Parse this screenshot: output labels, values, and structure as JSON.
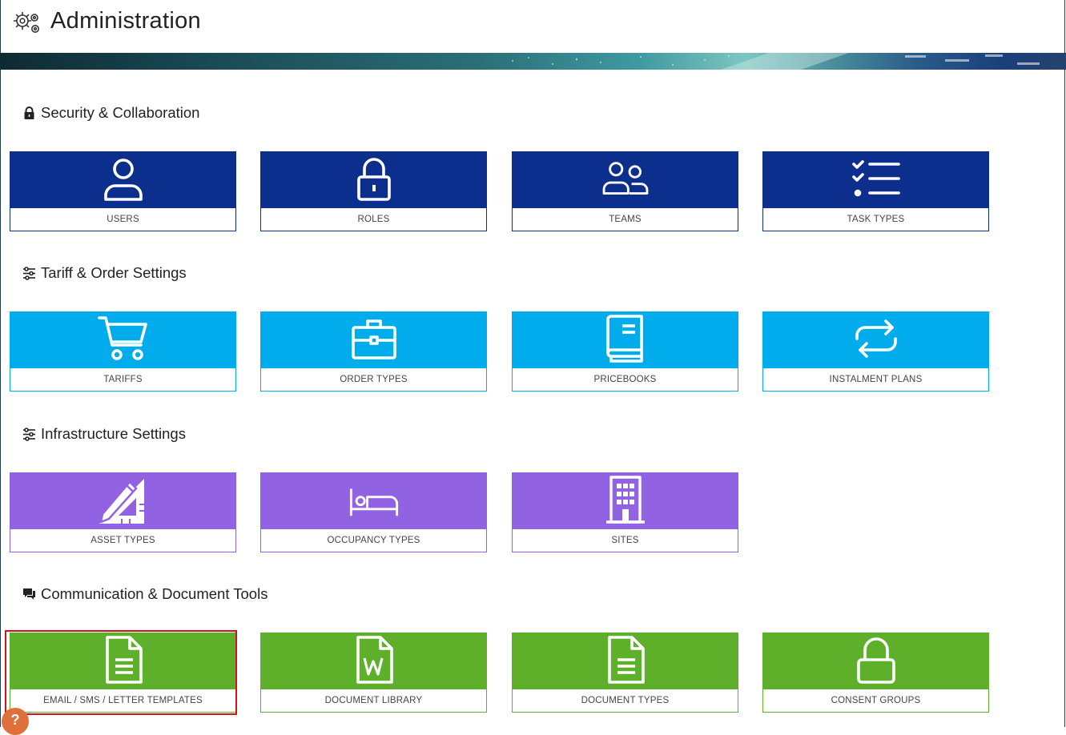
{
  "header": {
    "title": "Administration",
    "icon": "gears-icon"
  },
  "sections": [
    {
      "title": "Security & Collaboration",
      "icon": "lock-icon",
      "tiles": [
        {
          "label": "USERS",
          "icon": "user-icon"
        },
        {
          "label": "ROLES",
          "icon": "padlock-icon"
        },
        {
          "label": "TEAMS",
          "icon": "team-icon"
        },
        {
          "label": "TASK TYPES",
          "icon": "checklist-icon"
        }
      ]
    },
    {
      "title": "Tariff & Order Settings",
      "icon": "sliders-icon",
      "tiles": [
        {
          "label": "TARIFFS",
          "icon": "cart-icon"
        },
        {
          "label": "ORDER TYPES",
          "icon": "briefcase-icon"
        },
        {
          "label": "PRICEBOOKS",
          "icon": "book-icon"
        },
        {
          "label": "INSTALMENT PLANS",
          "icon": "repeat-icon"
        }
      ]
    },
    {
      "title": "Infrastructure Settings",
      "icon": "sliders-icon",
      "tiles": [
        {
          "label": "ASSET TYPES",
          "icon": "drafting-tools-icon"
        },
        {
          "label": "OCCUPANCY TYPES",
          "icon": "bed-icon"
        },
        {
          "label": "SITES",
          "icon": "building-icon"
        }
      ]
    },
    {
      "title": "Communication & Document Tools",
      "icon": "chat-bubbles-icon",
      "tiles": [
        {
          "label": "EMAIL / SMS / LETTER TEMPLATES",
          "icon": "document-icon"
        },
        {
          "label": "DOCUMENT LIBRARY",
          "icon": "word-document-icon"
        },
        {
          "label": "DOCUMENT TYPES",
          "icon": "document-icon"
        },
        {
          "label": "CONSENT GROUPS",
          "icon": "padlock-open-icon"
        }
      ]
    }
  ],
  "colors": {
    "security": "#0c2f8e",
    "tariff": "#00acec",
    "infrastructure": "#9163e3",
    "communication": "#5eaf2a",
    "highlight": "#d0151a"
  },
  "help": {
    "label": "?"
  }
}
